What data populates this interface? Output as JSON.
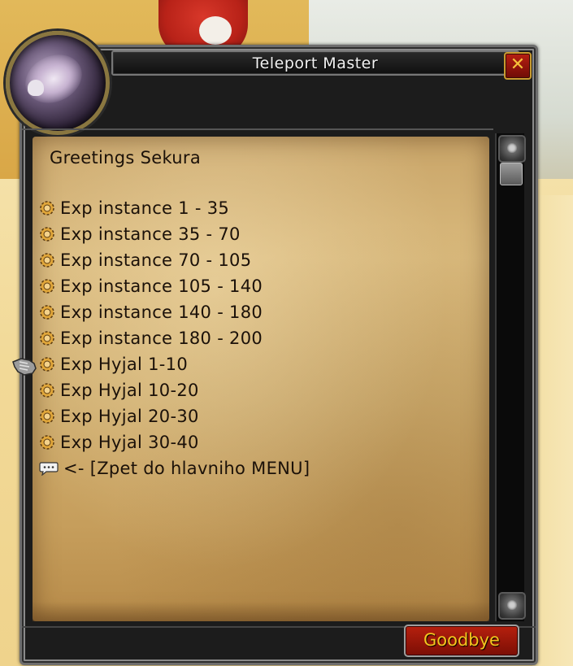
{
  "window": {
    "title": "Teleport Master",
    "close_label": "✕"
  },
  "greeting": "Greetings Sekura",
  "options": [
    {
      "label": "Exp instance 1 - 35",
      "icon": "gear-icon"
    },
    {
      "label": "Exp instance 35 - 70",
      "icon": "gear-icon"
    },
    {
      "label": "Exp instance 70 - 105",
      "icon": "gear-icon"
    },
    {
      "label": "Exp instance 105 - 140",
      "icon": "gear-icon"
    },
    {
      "label": "Exp instance 140 - 180",
      "icon": "gear-icon"
    },
    {
      "label": "Exp instance 180 - 200",
      "icon": "gear-icon"
    },
    {
      "label": "Exp Hyjal 1-10",
      "icon": "gear-icon"
    },
    {
      "label": "Exp Hyjal 10-20",
      "icon": "gear-icon"
    },
    {
      "label": "Exp Hyjal 20-30",
      "icon": "gear-icon"
    },
    {
      "label": "Exp Hyjal 30-40",
      "icon": "gear-icon"
    },
    {
      "label": "<- [Zpet do hlavniho MENU]",
      "icon": "chat-bubble-icon"
    }
  ],
  "footer": {
    "goodbye_label": "Goodbye"
  },
  "colors": {
    "title_text": "#f2f2f2",
    "option_text": "#1b1109",
    "button_gold": "#f5c51e",
    "button_red": "#b6200e"
  }
}
